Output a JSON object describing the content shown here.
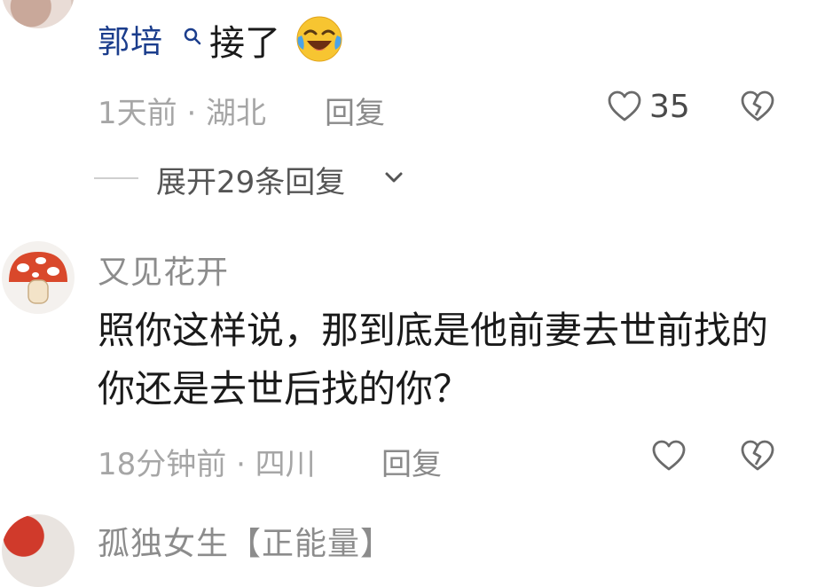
{
  "comments": [
    {
      "username": "郭培",
      "text": "接了",
      "emoji": "tears-of-joy-emoji",
      "meta": "1天前 · 湖北",
      "reply_label": "回复",
      "likes": "35",
      "expand_label": "展开29条回复"
    },
    {
      "username": "又见花开",
      "text": "照你这样说，那到底是他前妻去世前找的你还是去世后找的你？",
      "meta": "18分钟前 · 四川",
      "reply_label": "回复"
    },
    {
      "username": "孤独女生【正能量】"
    }
  ],
  "colors": {
    "username_link": "#1b3d8c",
    "username_gray": "#8c8c8c",
    "meta_gray": "#a6a6a6",
    "text": "#1a1a1a"
  }
}
